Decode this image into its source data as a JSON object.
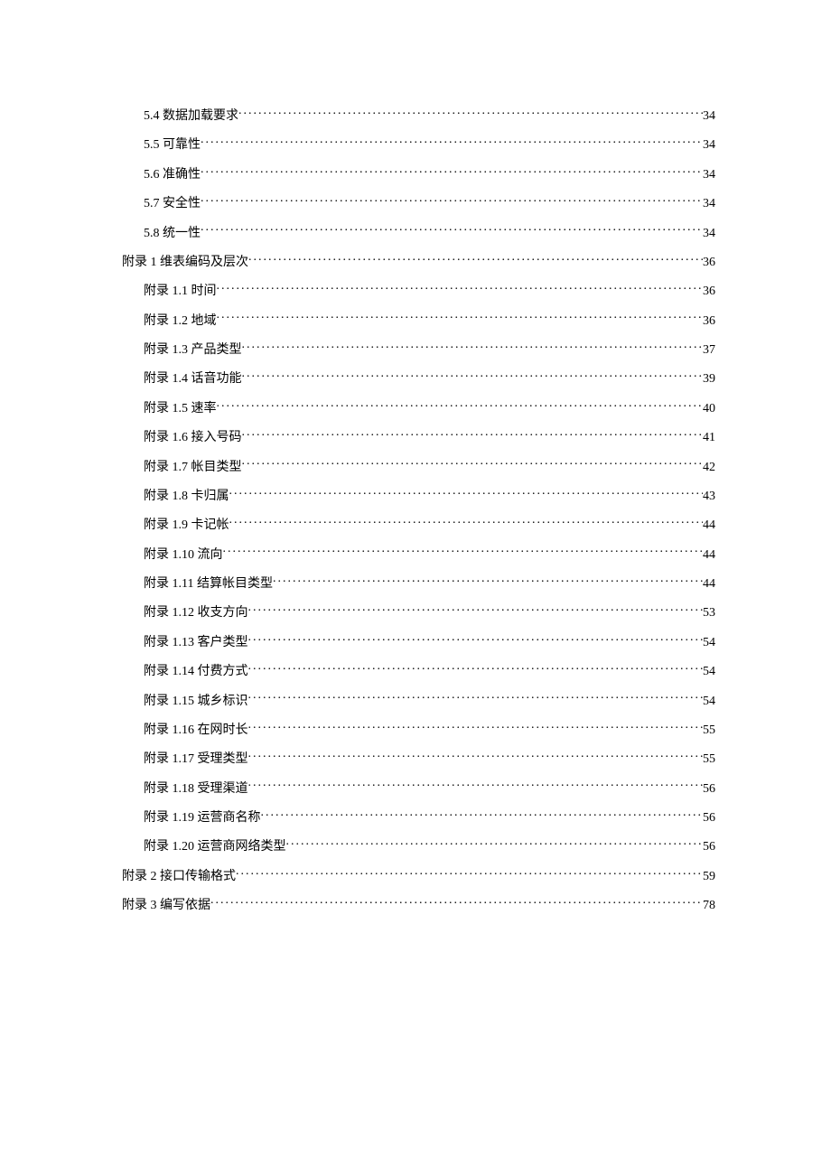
{
  "toc": [
    {
      "level": 2,
      "label": "5.4  数据加载要求",
      "page": "34"
    },
    {
      "level": 2,
      "label": "5.5  可靠性",
      "page": "34"
    },
    {
      "level": 2,
      "label": "5.6  准确性",
      "page": "34"
    },
    {
      "level": 2,
      "label": "5.7  安全性",
      "page": "34"
    },
    {
      "level": 2,
      "label": "5.8  统一性",
      "page": "34"
    },
    {
      "level": 1,
      "label": "附录 1  维表编码及层次",
      "page": "36"
    },
    {
      "level": 2,
      "label": "附录 1.1  时间",
      "page": "36"
    },
    {
      "level": 2,
      "label": "附录 1.2  地域",
      "page": "36"
    },
    {
      "level": 2,
      "label": "附录 1.3  产品类型",
      "page": "37"
    },
    {
      "level": 2,
      "label": "附录 1.4  话音功能",
      "page": "39"
    },
    {
      "level": 2,
      "label": "附录 1.5  速率",
      "page": "40"
    },
    {
      "level": 2,
      "label": "附录 1.6  接入号码",
      "page": "41"
    },
    {
      "level": 2,
      "label": "附录 1.7  帐目类型",
      "page": "42"
    },
    {
      "level": 2,
      "label": "附录 1.8  卡归属",
      "page": "43"
    },
    {
      "level": 2,
      "label": "附录 1.9  卡记帐",
      "page": "44"
    },
    {
      "level": 2,
      "label": "附录 1.10  流向",
      "page": "44"
    },
    {
      "level": 2,
      "label": "附录 1.11  结算帐目类型",
      "page": "44"
    },
    {
      "level": 2,
      "label": "附录 1.12  收支方向",
      "page": "53"
    },
    {
      "level": 2,
      "label": "附录 1.13  客户类型",
      "page": "54"
    },
    {
      "level": 2,
      "label": "附录 1.14  付费方式",
      "page": "54"
    },
    {
      "level": 2,
      "label": "附录 1.15  城乡标识",
      "page": "54"
    },
    {
      "level": 2,
      "label": "附录 1.16  在网时长",
      "page": "55"
    },
    {
      "level": 2,
      "label": "附录 1.17  受理类型",
      "page": "55"
    },
    {
      "level": 2,
      "label": "附录 1.18  受理渠道",
      "page": "56"
    },
    {
      "level": 2,
      "label": "附录 1.19  运营商名称",
      "page": "56"
    },
    {
      "level": 2,
      "label": "附录 1.20  运营商网络类型",
      "page": "56"
    },
    {
      "level": 1,
      "label": "附录 2  接口传输格式",
      "page": "59"
    },
    {
      "level": 1,
      "label": "附录 3  编写依据",
      "page": "78"
    }
  ]
}
